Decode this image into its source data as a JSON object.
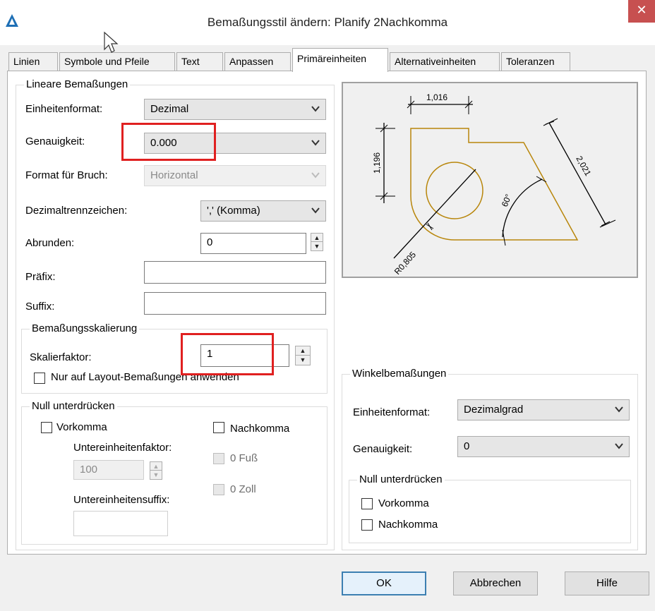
{
  "window": {
    "title": "Bemaßungsstil ändern: Planify 2Nachkomma",
    "close_glyph": "✕"
  },
  "tabs": [
    {
      "label": "Linien"
    },
    {
      "label": "Symbole und Pfeile"
    },
    {
      "label": "Text"
    },
    {
      "label": "Anpassen"
    },
    {
      "label": "Primäreinheiten"
    },
    {
      "label": "Alternativeinheiten"
    },
    {
      "label": "Toleranzen"
    }
  ],
  "active_tab": "Primäreinheiten",
  "linear": {
    "legend": "Lineare Bemaßungen",
    "unit_format_label": "Einheitenformat:",
    "unit_format_value": "Dezimal",
    "precision_label": "Genauigkeit:",
    "precision_value": "0.000",
    "fraction_format_label": "Format für Bruch:",
    "fraction_format_value": "Horizontal",
    "decimal_sep_label": "Dezimaltrennzeichen:",
    "decimal_sep_value": "',' (Komma)",
    "round_label": "Abrunden:",
    "round_value": "0",
    "prefix_label": "Präfix:",
    "prefix_value": "",
    "suffix_label": "Suffix:",
    "suffix_value": ""
  },
  "scaling": {
    "legend": "Bemaßungsskalierung",
    "factor_label": "Skalierfaktor:",
    "factor_value": "1",
    "layout_only_label": "Nur auf Layout-Bemaßungen anwenden",
    "layout_only_checked": false
  },
  "zero_linear": {
    "legend": "Null unterdrücken",
    "leading_label": "Vorkomma",
    "trailing_label": "Nachkomma",
    "subunit_factor_label": "Untereinheitenfaktor:",
    "subunit_factor_value": "100",
    "subunit_suffix_label": "Untereinheitensuffix:",
    "subunit_suffix_value": "",
    "zero_feet_label": "0 Fuß",
    "zero_inch_label": "0 Zoll"
  },
  "angular": {
    "legend": "Winkelbemaßungen",
    "unit_format_label": "Einheitenformat:",
    "unit_format_value": "Dezimalgrad",
    "precision_label": "Genauigkeit:",
    "precision_value": "0",
    "zero_legend": "Null unterdrücken",
    "leading_label": "Vorkomma",
    "trailing_label": "Nachkomma"
  },
  "preview": {
    "dim_top": "1,016",
    "dim_left": "1,196",
    "dim_diag": "2,021",
    "dim_angle": "60°",
    "dim_radius": "R0,805"
  },
  "buttons": {
    "ok": "OK",
    "cancel": "Abbrechen",
    "help": "Hilfe"
  },
  "colors": {
    "highlight": "#e02020",
    "geometry": "#b8860b",
    "close": "#c75050"
  }
}
